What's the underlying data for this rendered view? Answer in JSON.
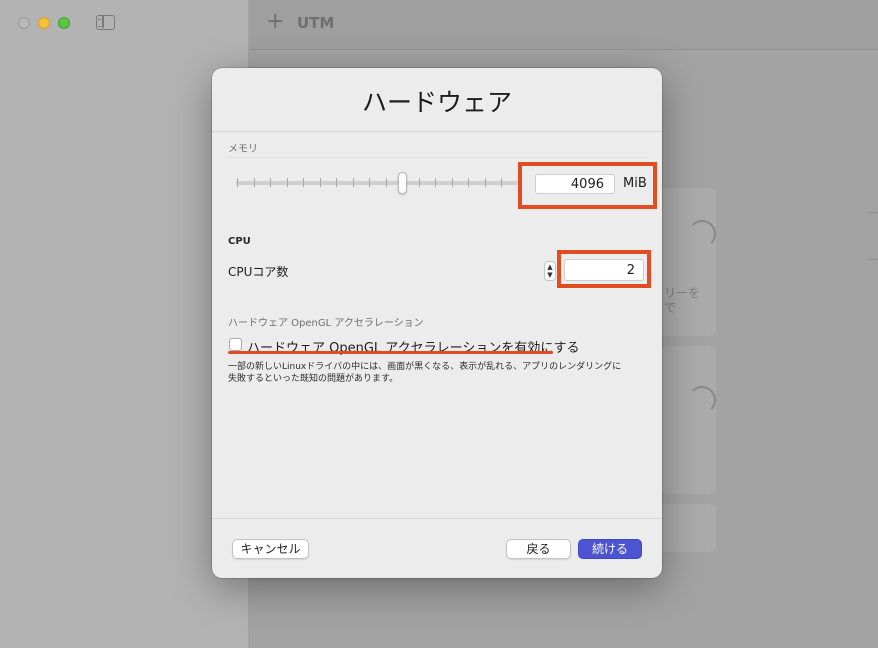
{
  "app": {
    "title": "UTM"
  },
  "background": {
    "partial_text": [
      "リーを",
      "で"
    ]
  },
  "dialog": {
    "title": "ハードウェア",
    "memory": {
      "section_label": "メモリ",
      "slider_fraction": 0.59,
      "value": "4096",
      "unit": "MiB"
    },
    "cpu": {
      "section_label": "CPU",
      "cores_label": "CPUコア数",
      "cores_value": "2"
    },
    "opengl": {
      "section_label": "ハードウェア OpenGL アクセラレーション",
      "checkbox_label": "ハードウェア OpenGL アクセラレーションを有効にする",
      "checked": false,
      "note_line1": "一部の新しいLinuxドライバの中には、画面が黒くなる、表示が乱れる、アプリのレンダリングに",
      "note_line2": "失敗するといった既知の問題があります。"
    },
    "buttons": {
      "cancel": "キャンセル",
      "back": "戻る",
      "continue": "続ける"
    }
  },
  "colors": {
    "accent": "#4c54d2",
    "highlight": "#e24c22",
    "traffic_min": "#f6c03a",
    "traffic_max": "#5cc444"
  }
}
